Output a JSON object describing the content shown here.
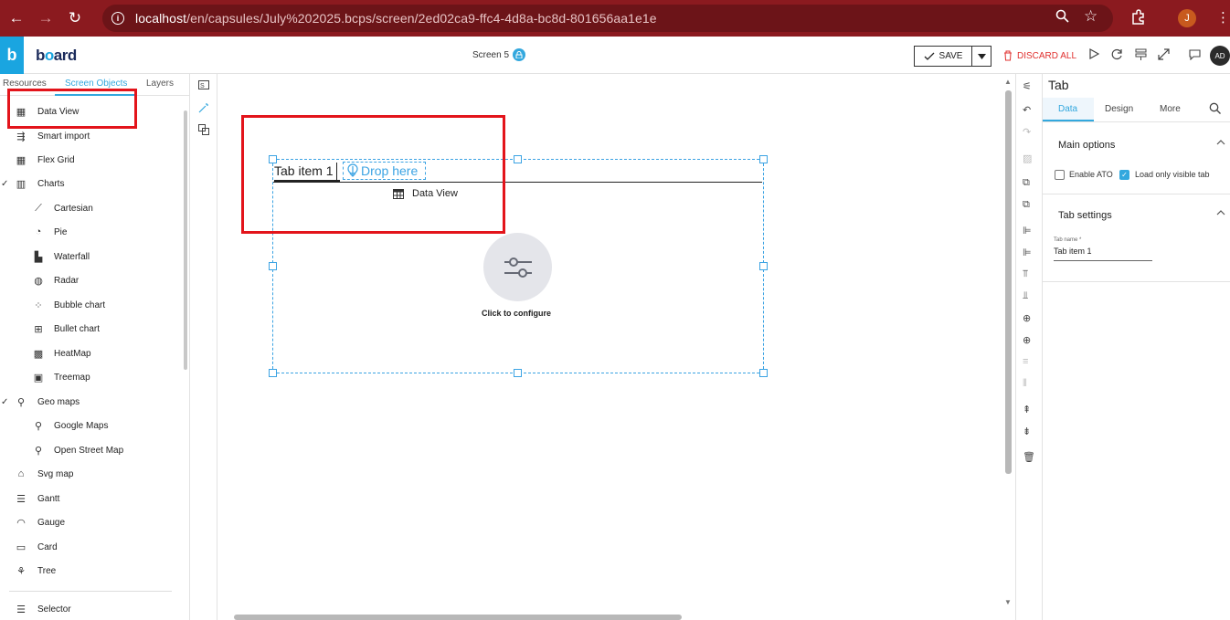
{
  "browser": {
    "url_host": "localhost",
    "url_path": "/en/capsules/July%202025.bcps/screen/2ed02ca9-ffc4-4d8a-bc8d-801656aa1e1e",
    "profile_initial": "J"
  },
  "app": {
    "logo_letter": "b",
    "logo_text_1": "b",
    "logo_text_o": "o",
    "logo_text_2": "ard",
    "screen_name": "Screen 5",
    "save_label": "SAVE",
    "discard_label": "DISCARD ALL",
    "avatar_initials": "AD"
  },
  "left_panel": {
    "tabs": [
      "Resources",
      "Screen Objects",
      "Layers"
    ],
    "active_tab": "Screen Objects",
    "items": [
      {
        "label": "Data View",
        "icon": "table-icon",
        "indent": 0,
        "check": ""
      },
      {
        "label": "Smart import",
        "icon": "smart-import-icon",
        "indent": 0,
        "check": ""
      },
      {
        "label": "Flex Grid",
        "icon": "grid-icon",
        "indent": 0,
        "check": ""
      },
      {
        "label": "Charts",
        "icon": "bar-chart-icon",
        "indent": 0,
        "check": "✓"
      },
      {
        "label": "Cartesian",
        "icon": "line-chart-icon",
        "indent": 1,
        "check": ""
      },
      {
        "label": "Pie",
        "icon": "pie-chart-icon",
        "indent": 1,
        "check": ""
      },
      {
        "label": "Waterfall",
        "icon": "waterfall-icon",
        "indent": 1,
        "check": ""
      },
      {
        "label": "Radar",
        "icon": "radar-icon",
        "indent": 1,
        "check": ""
      },
      {
        "label": "Bubble chart",
        "icon": "bubble-chart-icon",
        "indent": 1,
        "check": ""
      },
      {
        "label": "Bullet chart",
        "icon": "bullet-chart-icon",
        "indent": 1,
        "check": ""
      },
      {
        "label": "HeatMap",
        "icon": "heatmap-icon",
        "indent": 1,
        "check": ""
      },
      {
        "label": "Treemap",
        "icon": "treemap-icon",
        "indent": 1,
        "check": ""
      },
      {
        "label": "Geo maps",
        "icon": "map-pin-icon",
        "indent": 0,
        "check": "✓"
      },
      {
        "label": "Google Maps",
        "icon": "google-maps-icon",
        "indent": 1,
        "check": ""
      },
      {
        "label": "Open Street Map",
        "icon": "osm-icon",
        "indent": 1,
        "check": ""
      },
      {
        "label": "Svg map",
        "icon": "svg-map-icon",
        "indent": 0,
        "check": ""
      },
      {
        "label": "Gantt",
        "icon": "gantt-icon",
        "indent": 0,
        "check": ""
      },
      {
        "label": "Gauge",
        "icon": "gauge-icon",
        "indent": 0,
        "check": ""
      },
      {
        "label": "Card",
        "icon": "card-icon",
        "indent": 0,
        "check": ""
      },
      {
        "label": "Tree",
        "icon": "tree-icon",
        "indent": 0,
        "check": ""
      },
      {
        "label": "Selector",
        "icon": "selector-icon",
        "indent": 0,
        "check": ""
      }
    ]
  },
  "canvas": {
    "tab_item_label": "Tab item 1",
    "drop_here_label": "Drop here",
    "inner_object_label": "Data View",
    "configure_label": "Click to configure"
  },
  "properties": {
    "title": "Tab",
    "tabs": [
      "Data",
      "Design",
      "More"
    ],
    "active_tab": "Data",
    "main_options_title": "Main options",
    "enable_ato_label": "Enable ATO",
    "enable_ato_checked": false,
    "load_visible_label": "Load only visible tab",
    "load_visible_checked": true,
    "tab_settings_title": "Tab settings",
    "tab_name_label": "Tab name *",
    "tab_name_value": "Tab item 1"
  },
  "colors": {
    "browser_bar": "#8b1a1f",
    "accent": "#33a8de",
    "highlight_box": "#e3141b",
    "discard": "#e0312f"
  }
}
